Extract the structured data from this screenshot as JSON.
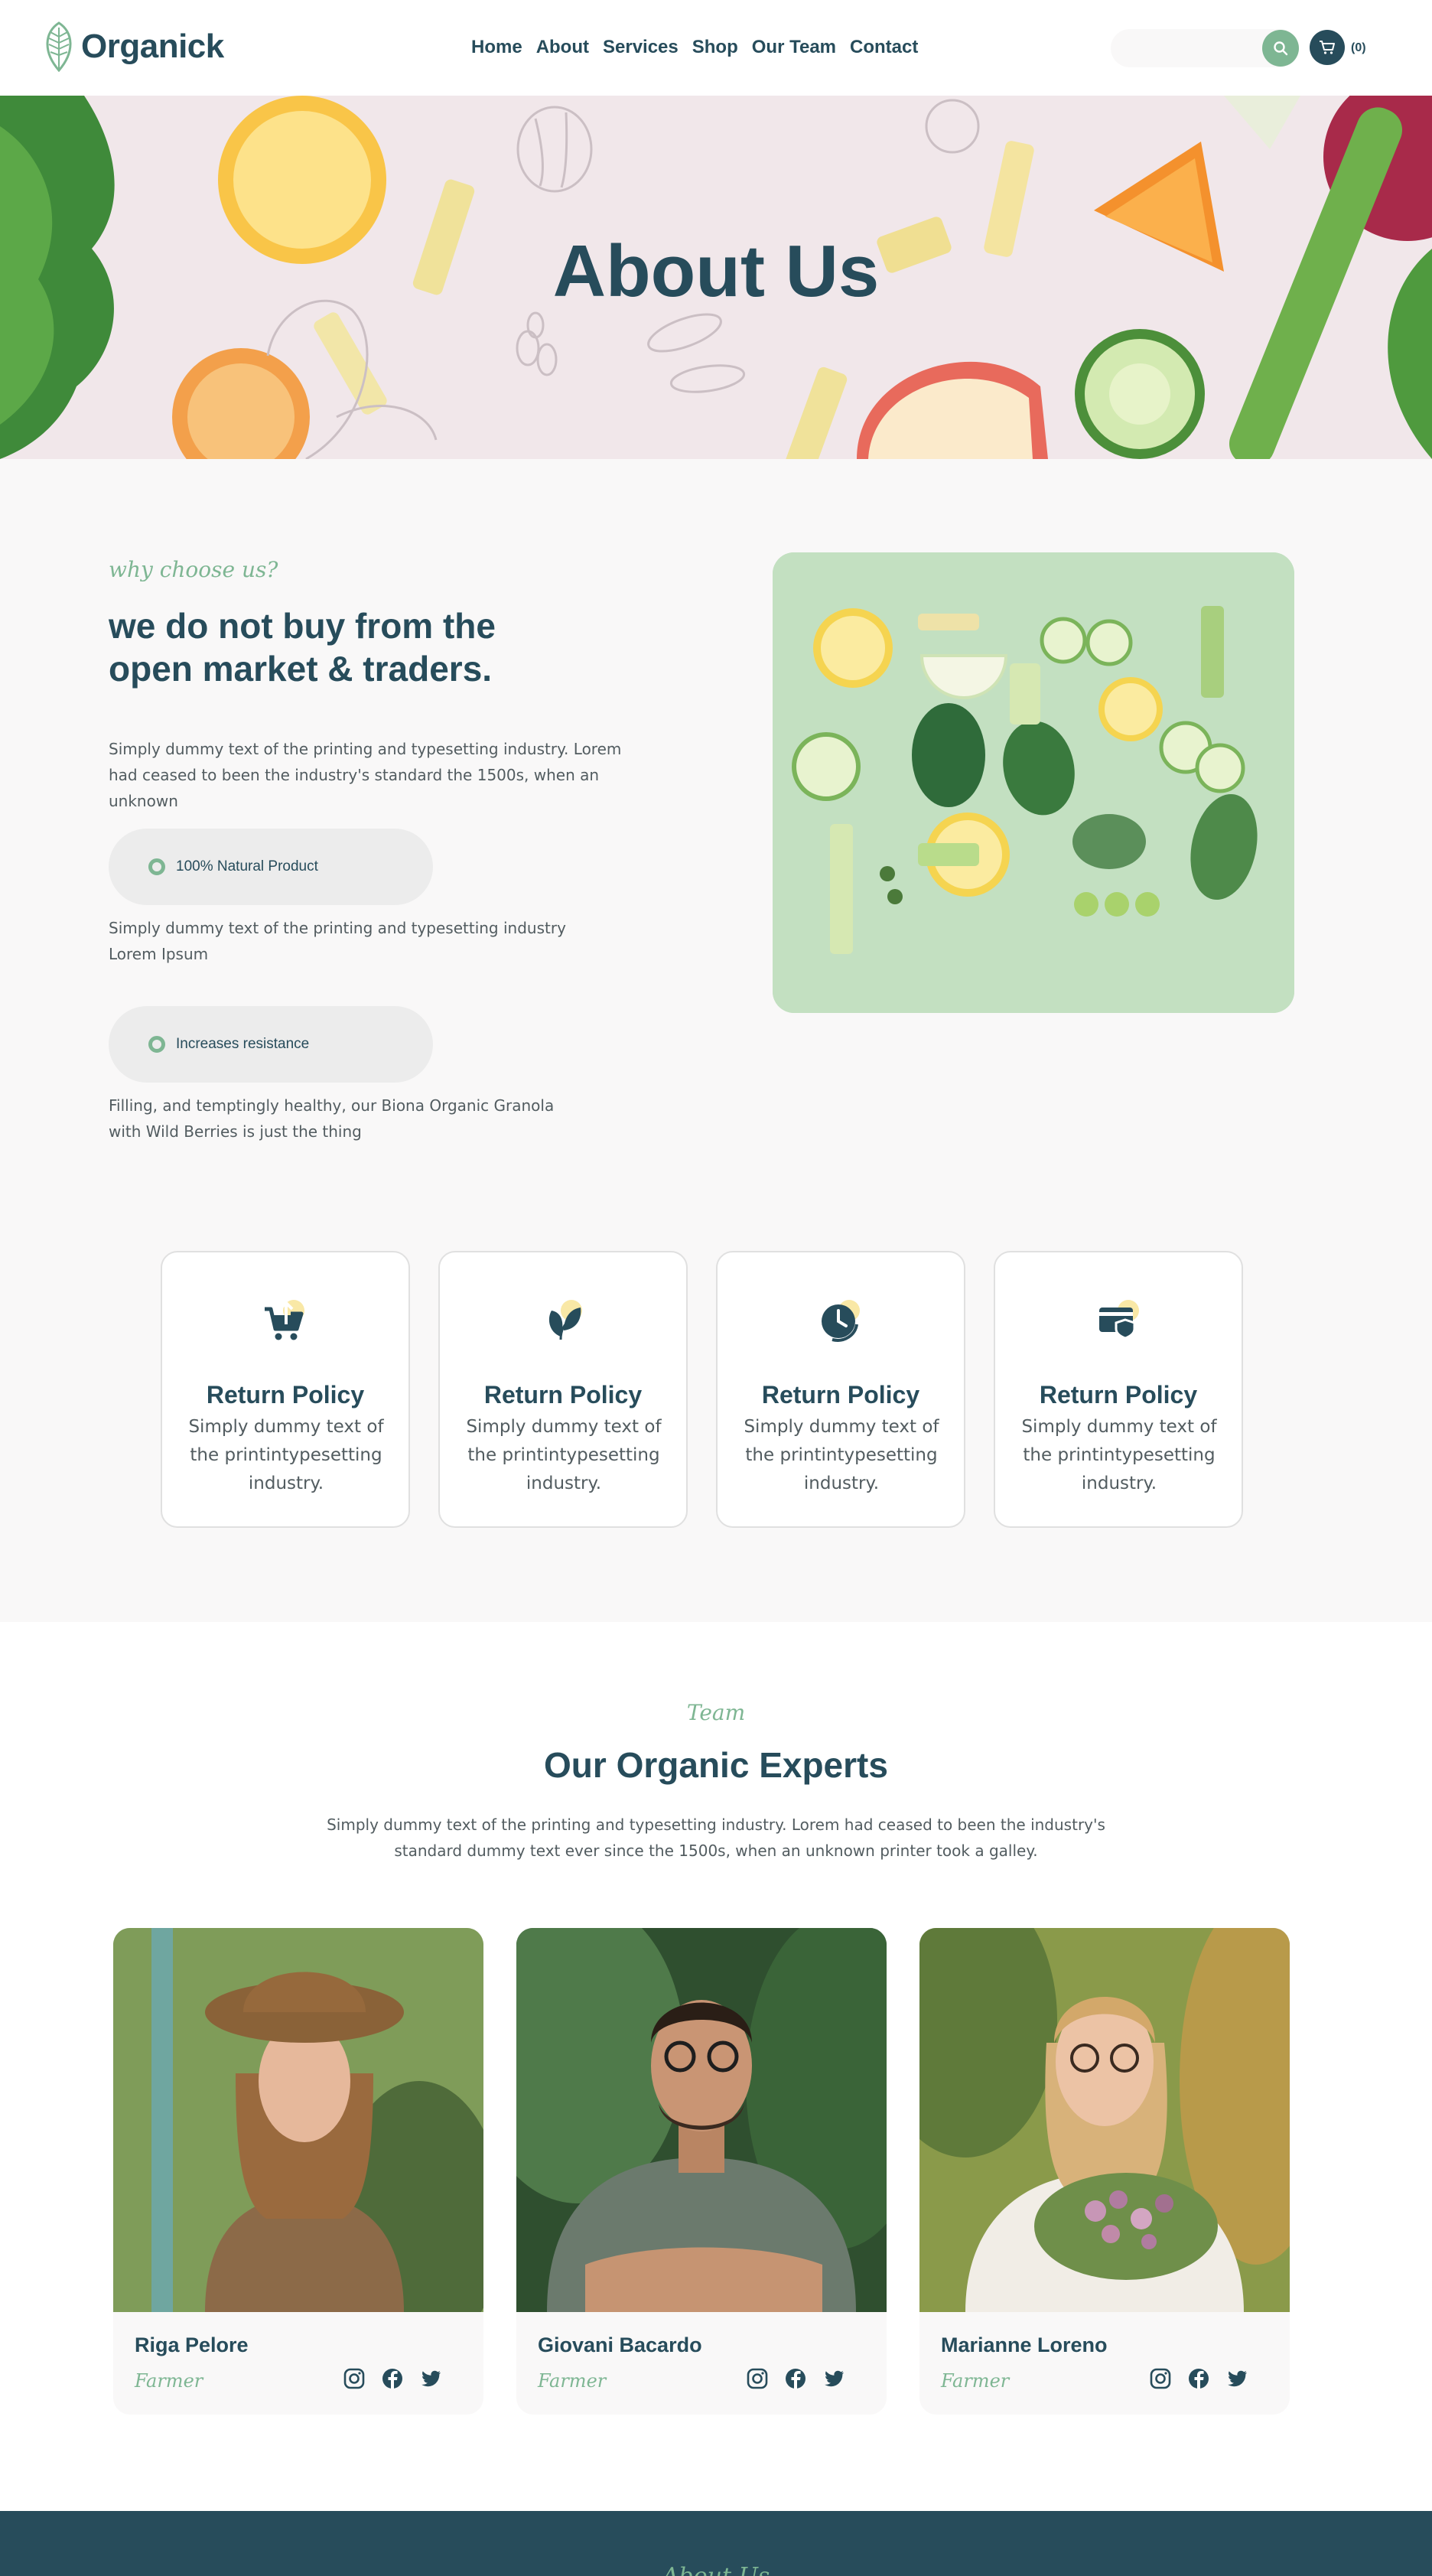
{
  "brand": {
    "name": "Organick",
    "accent": "#7eb693",
    "dark": "#274c5b"
  },
  "nav": [
    {
      "label": "Home"
    },
    {
      "label": "About"
    },
    {
      "label": "Services"
    },
    {
      "label": "Shop"
    },
    {
      "label": "Our Team"
    },
    {
      "label": "Contact"
    }
  ],
  "search": {
    "placeholder": ""
  },
  "cart": {
    "count": "(0)"
  },
  "hero": {
    "title": "About Us"
  },
  "why": {
    "subtitle": "why choose us?",
    "title": "we do not buy from the open market & traders.",
    "description": "Simply dummy text of the printing and typesetting industry. Lorem had ceased to been the industry's standard the 1500s, when an unknown",
    "features": [
      {
        "label": "100% Natural Product",
        "text": "Simply dummy text of the printing and typesetting industry Lorem Ipsum"
      },
      {
        "label": "Increases resistance",
        "text": "Filling, and temptingly healthy, our Biona Organic Granola with Wild Berries is just the thing"
      }
    ]
  },
  "cards": [
    {
      "icon": "cart-upload-icon",
      "title": "Return Policy",
      "text": "Simply dummy text of the printintypesetting industry."
    },
    {
      "icon": "leaf-icon",
      "title": "Return Policy",
      "text": "Simply dummy text of the printintypesetting industry."
    },
    {
      "icon": "clock-icon",
      "title": "Return Policy",
      "text": "Simply dummy text of the printintypesetting industry."
    },
    {
      "icon": "secure-card-icon",
      "title": "Return Policy",
      "text": "Simply dummy text of the printintypesetting industry."
    }
  ],
  "team": {
    "subtitle": "Team",
    "title": "Our Organic Experts",
    "description": "Simply dummy text of the printing and typesetting industry. Lorem had ceased to been the industry's standard dummy text ever since the 1500s, when an unknown printer took a galley.",
    "members": [
      {
        "name": "Riga Pelore",
        "role": "Farmer"
      },
      {
        "name": "Giovani Bacardo",
        "role": "Farmer"
      },
      {
        "name": "Marianne Loreno",
        "role": "Farmer"
      }
    ]
  },
  "footer": {
    "subtitle": "About Us"
  }
}
